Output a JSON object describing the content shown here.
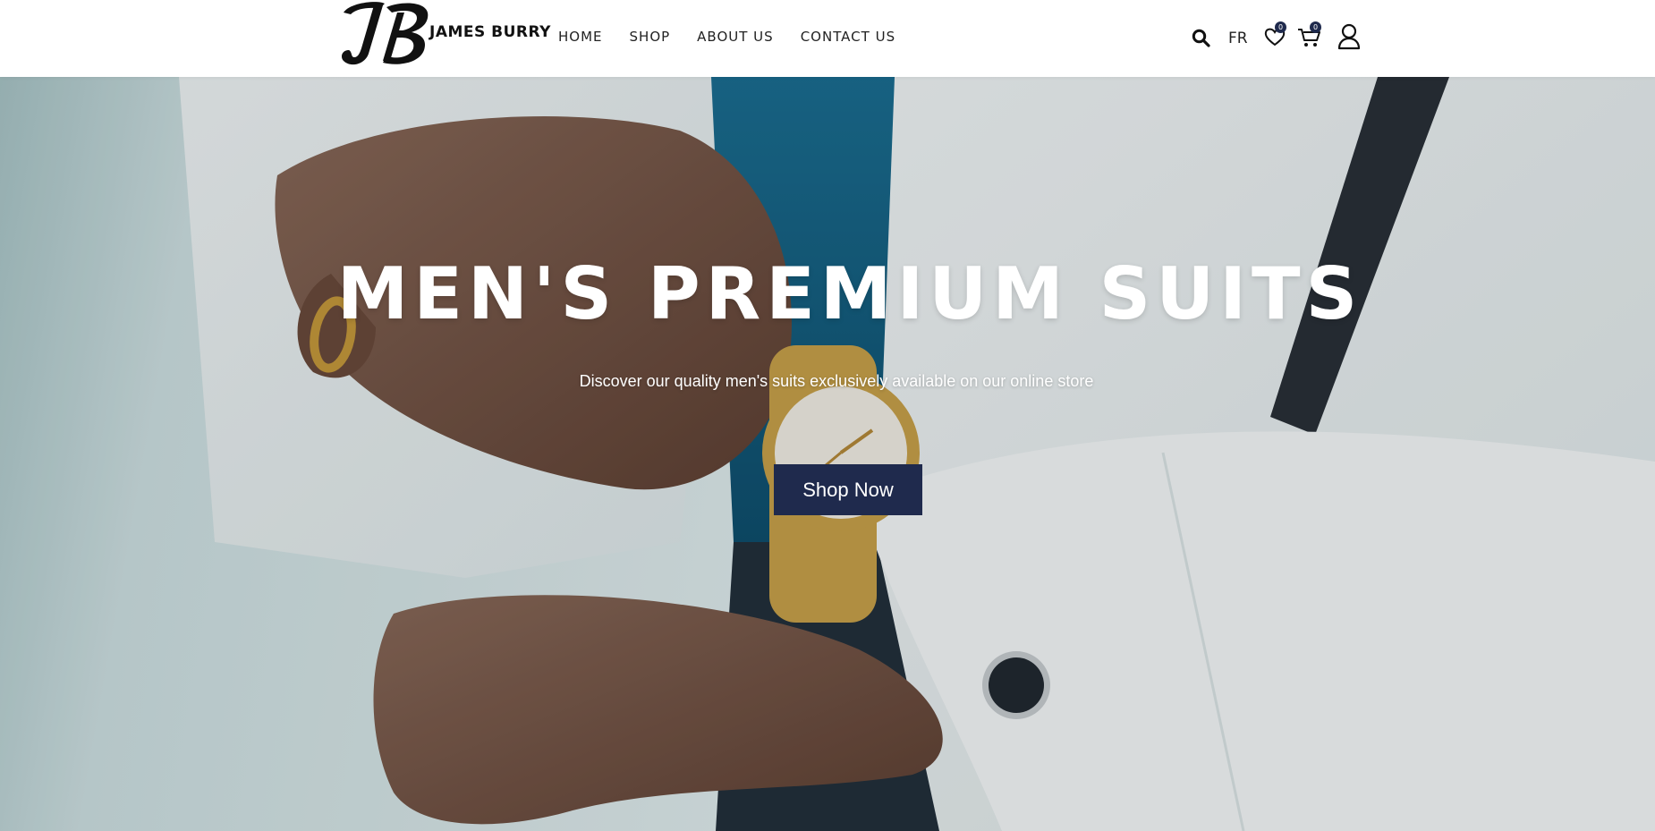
{
  "brand": {
    "logo_monogram": "JB",
    "name": "JAMES BURRY"
  },
  "nav": {
    "items": [
      {
        "label": "HOME"
      },
      {
        "label": "SHOP"
      },
      {
        "label": "ABOUT US"
      },
      {
        "label": "CONTACT US"
      }
    ]
  },
  "header_tools": {
    "language": "FR",
    "wishlist_count": "0",
    "cart_count": "0",
    "icons": [
      "search-icon",
      "heart-icon",
      "cart-icon",
      "user-icon"
    ]
  },
  "hero": {
    "title": "MEN'S PREMIUM SUITS",
    "subtitle": "Discover our quality men's suits exclusively available on our online store",
    "cta_label": "Shop Now"
  },
  "colors": {
    "primary": "#1f2a4d",
    "text_dark": "#222222",
    "hero_text": "#ffffff"
  }
}
